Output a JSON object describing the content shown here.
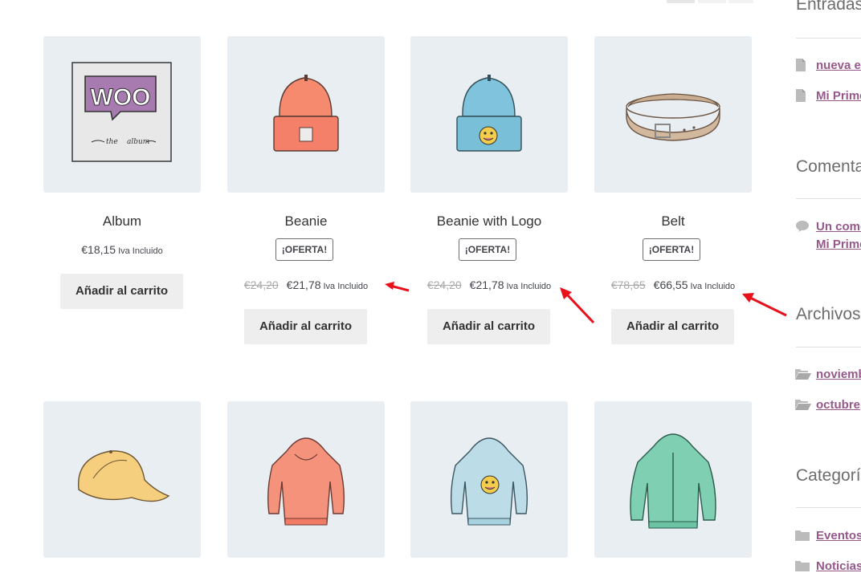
{
  "colors": {
    "accent_link": "#96588a",
    "thumb_bg": "#e9eef2",
    "button_bg": "#eeeeee",
    "arrow": "#e8101a"
  },
  "products_row1": [
    {
      "title": "Album",
      "price": "€18,15",
      "tax": "Iva Incluido",
      "button": "Añadir al carrito",
      "image": "woo-album-image"
    },
    {
      "title": "Beanie",
      "badge": "¡OFERTA!",
      "old_price": "€24,20",
      "price": "€21,78",
      "tax": "Iva Incluido",
      "button": "Añadir al carrito",
      "image": "orange-beanie-image"
    },
    {
      "title": "Beanie with Logo",
      "badge": "¡OFERTA!",
      "old_price": "€24,20",
      "price": "€21,78",
      "tax": "Iva Incluido",
      "button": "Añadir al carrito",
      "image": "blue-beanie-logo-image"
    },
    {
      "title": "Belt",
      "badge": "¡OFERTA!",
      "old_price": "€78,65",
      "price": "€66,55",
      "tax": "Iva Incluido",
      "button": "Añadir al carrito",
      "image": "belt-image"
    }
  ],
  "products_row2": [
    {
      "image": "cap-image"
    },
    {
      "image": "pink-hoodie-image"
    },
    {
      "image": "blue-hoodie-logo-image"
    },
    {
      "image": "green-zip-hoodie-image"
    }
  ],
  "sidebar": {
    "entradas": {
      "title": "Entradas",
      "items": [
        "nueva en",
        "Mi Prime"
      ]
    },
    "comentarios": {
      "title": "Comenta",
      "comment_line1": "Un come",
      "comment_line2": "Mi Prime"
    },
    "archivos": {
      "title": "Archivos",
      "items": [
        "noviemb",
        "octubre"
      ]
    },
    "categorias": {
      "title": "Categoría",
      "items": [
        "Eventos",
        "Noticias"
      ]
    }
  }
}
